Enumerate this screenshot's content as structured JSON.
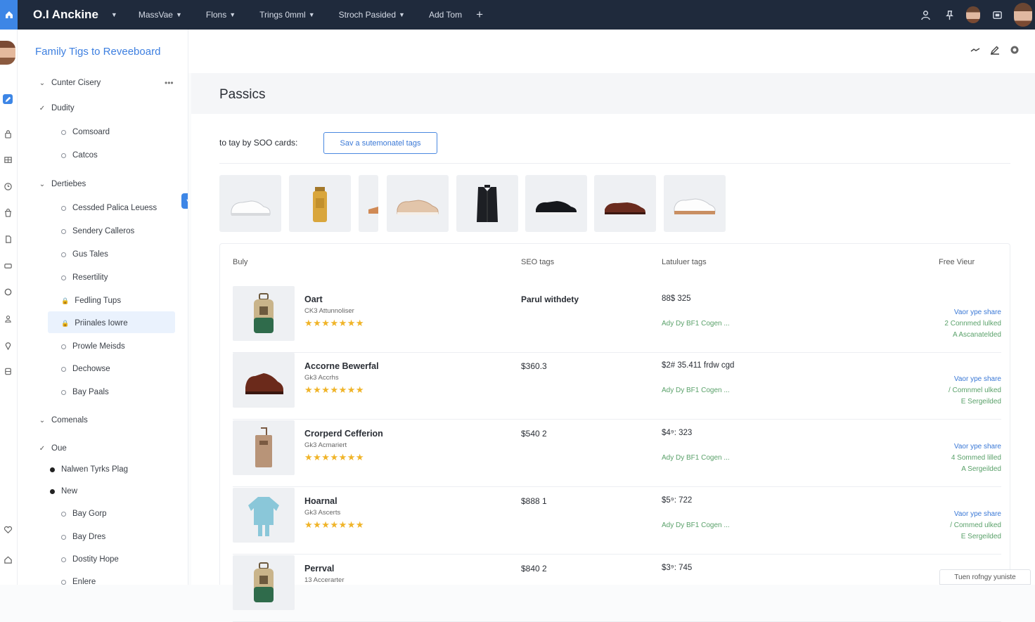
{
  "topbar": {
    "brand": "O.I Anckine",
    "nav": [
      "MassVae",
      "Flons",
      "Trings 0mml",
      "Stroch Pasided"
    ],
    "add_label": "Add Tom"
  },
  "sidebar": {
    "title": "Family Tigs to Reveeboard",
    "items": [
      {
        "label": "Cunter Cisery",
        "kind": "chev",
        "level": 0
      },
      {
        "label": "Dudity",
        "kind": "check",
        "level": 0
      },
      {
        "label": "Comsoard",
        "kind": "dot",
        "level": 1
      },
      {
        "label": "Catcos",
        "kind": "dot",
        "level": 1
      },
      {
        "label": "Dertiebes",
        "kind": "chev",
        "level": 0
      },
      {
        "label": "Cessded Palica Leuess",
        "kind": "dot",
        "level": 1
      },
      {
        "label": "Sendery Calleros",
        "kind": "dot",
        "level": 1
      },
      {
        "label": "Gus Tales",
        "kind": "dot",
        "level": 1
      },
      {
        "label": "Resertility",
        "kind": "dot",
        "level": 1
      },
      {
        "label": "Fedling Tups",
        "kind": "lock",
        "level": 1
      },
      {
        "label": "Priinales Iowre",
        "kind": "lock",
        "level": 1
      },
      {
        "label": "Prowle Meisds",
        "kind": "dot",
        "level": 1
      },
      {
        "label": "Dechowse",
        "kind": "dot",
        "level": 1
      },
      {
        "label": "Bay Paals",
        "kind": "dot",
        "level": 1
      },
      {
        "label": "Comenals",
        "kind": "chev",
        "level": 0
      },
      {
        "label": "Oue",
        "kind": "check",
        "level": 0
      },
      {
        "label": "Nalwen Tyrks Plag",
        "kind": "bullet",
        "level": 2
      },
      {
        "label": "New",
        "kind": "bullet",
        "level": 2
      },
      {
        "label": "Bay Gorp",
        "kind": "dot",
        "level": 1
      },
      {
        "label": "Bay Dres",
        "kind": "dot",
        "level": 1
      },
      {
        "label": "Dostity Hope",
        "kind": "dot",
        "level": 1
      },
      {
        "label": "Enlere",
        "kind": "dot",
        "level": 1
      }
    ]
  },
  "main": {
    "title": "Passics",
    "filter_label": "to tay by SOO cards:",
    "filter_button": "Sav a sutemonatel tags",
    "thumbnails": [
      "white-sneaker",
      "tan-boot",
      "partial-shoe",
      "beige-sneaker",
      "black-vest",
      "black-sneaker",
      "brown-loafer",
      "white-sneaker-2"
    ]
  },
  "table": {
    "columns": [
      "Buly",
      "SEO tags",
      "Latuluer tags",
      "Free Vieur"
    ],
    "rows": [
      {
        "name": "Oart",
        "sub": "CK3 Attunnoliser",
        "stars": "★★★★★★★",
        "seo": "Parul withdety",
        "seo_bold": true,
        "latest": "88$ 325",
        "tagline": "Ady Dy BF1 Cogen ...",
        "view1": "Vaor ype share",
        "view2": "2 Connmed lulked",
        "view3": "A Ascanatelded",
        "image": "backpack"
      },
      {
        "name": "Accorne Bewerfal",
        "sub": "Gk3 Accrhs",
        "stars": "★★★★★★★",
        "seo": "$360.3",
        "seo_bold": false,
        "latest": "$2# 35.411 frdw cgd",
        "tagline": "Ady Dy BF1 Cogen ...",
        "view1": "Vaor ype share",
        "view2": "/ Comnmel ulked",
        "view3": "E Sergeilded",
        "image": "shoe"
      },
      {
        "name": "Crorperd Cefferion",
        "sub": "Gk3 Acmariert",
        "stars": "★★★★★★★",
        "seo": "$540 2",
        "seo_bold": false,
        "latest": "$4⁹: 323",
        "tagline": "Ady Dy BF1 Cogen ...",
        "view1": "Vaor ype share",
        "view2": "4 Sommed lilled",
        "view3": "A Sergeilded",
        "image": "bag"
      },
      {
        "name": "Hoarnal",
        "sub": "Gk3 Ascerts",
        "stars": "★★★★★★★",
        "seo": "$888 1",
        "seo_bold": false,
        "latest": "$5⁹: 722",
        "tagline": "Ady Dy BF1 Cogen ...",
        "view1": "Vaor ype share",
        "view2": "/ Commed ulked",
        "view3": "E Sergeilded",
        "image": "sweater"
      },
      {
        "name": "Perrval",
        "sub": "13 Accerarter",
        "stars": "",
        "seo": "$840 2",
        "seo_bold": false,
        "latest": "$3⁹: 745",
        "tagline": "",
        "view1": "",
        "view2": "",
        "view3": "",
        "image": "backpack"
      }
    ]
  },
  "toast": "Tuen rofngy yuniste",
  "colors": {
    "accent": "#3d86e6",
    "topbar": "#1f2a3c",
    "star": "#f0b429",
    "tag_green": "#5aa16a"
  }
}
